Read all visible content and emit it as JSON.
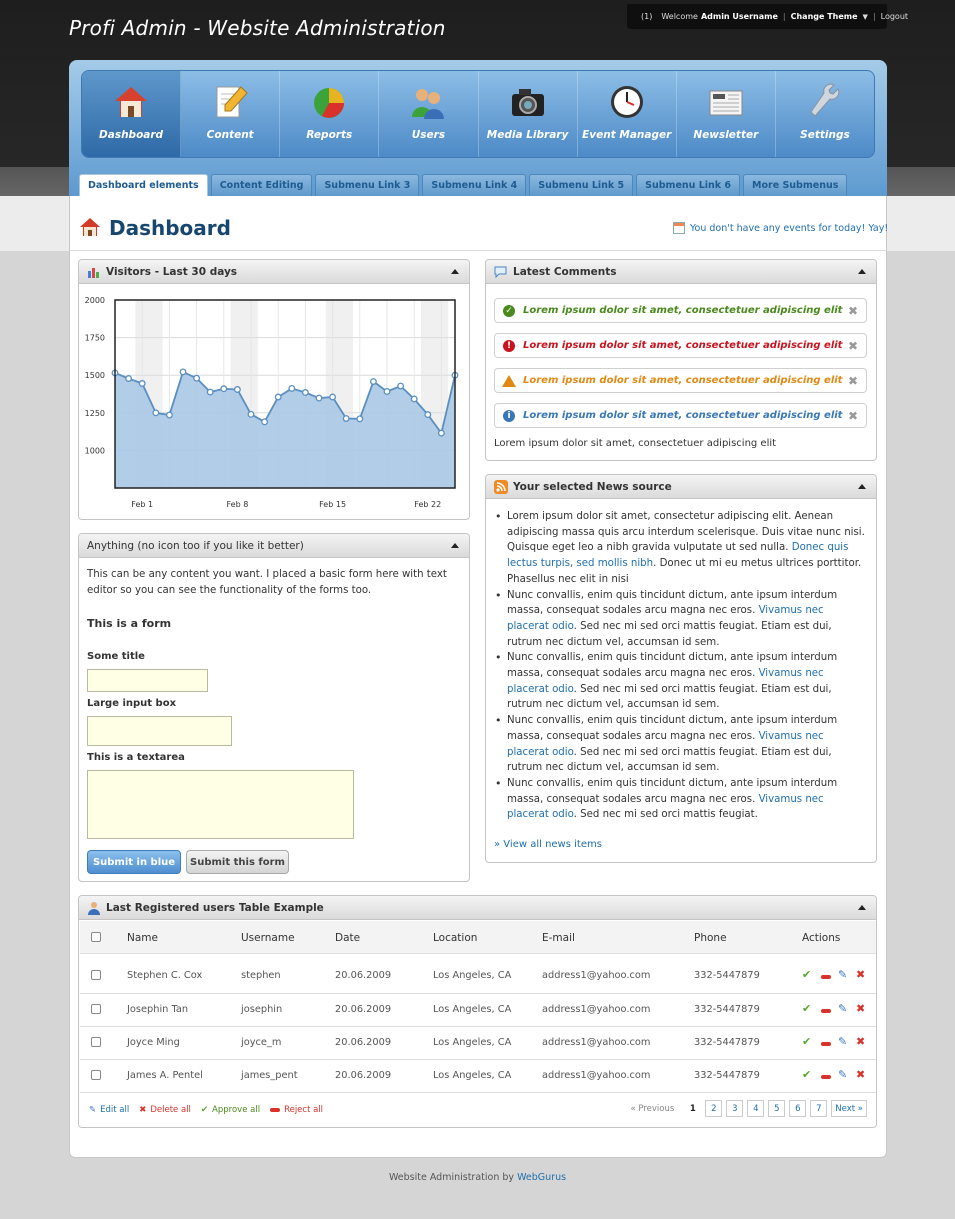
{
  "header": {
    "site_title": "Profi Admin - Website Administration",
    "userbar": {
      "mail_count": "(1)",
      "welcome": "Welcome",
      "username": "Admin Username",
      "change_theme": "Change Theme",
      "logout": "Logout"
    }
  },
  "nav": {
    "items": [
      {
        "label": "Dashboard",
        "icon": "house-icon",
        "active": true
      },
      {
        "label": "Content",
        "icon": "pencil-paper-icon"
      },
      {
        "label": "Reports",
        "icon": "pie-chart-icon"
      },
      {
        "label": "Users",
        "icon": "users-icon"
      },
      {
        "label": "Media Library",
        "icon": "camera-icon"
      },
      {
        "label": "Event Manager",
        "icon": "clock-icon"
      },
      {
        "label": "Newsletter",
        "icon": "newspaper-icon"
      },
      {
        "label": "Settings",
        "icon": "wrench-icon"
      }
    ]
  },
  "subnav": {
    "tabs": [
      {
        "label": "Dashboard elements",
        "active": true
      },
      {
        "label": "Content Editing"
      },
      {
        "label": "Submenu Link 3"
      },
      {
        "label": "Submenu Link 4"
      },
      {
        "label": "Submenu Link 5"
      },
      {
        "label": "Submenu Link 6"
      },
      {
        "label": "More Submenus"
      }
    ]
  },
  "page": {
    "title": "Dashboard",
    "events_notice": "You don't have any events for today! Yay!"
  },
  "visitors_panel": {
    "title": "Visitors - Last 30 days"
  },
  "chart_data": {
    "type": "area",
    "title": "Visitors - Last 30 days",
    "x_tick_labels": [
      "Feb 1",
      "Feb 8",
      "Feb 15",
      "Feb 22"
    ],
    "x_tick_positions": [
      3,
      10,
      17,
      24
    ],
    "y_ticks": [
      "2000",
      "1750",
      "1500",
      "1250",
      "1000"
    ],
    "ylim": [
      750,
      2000
    ],
    "grid": true,
    "values": [
      1515,
      1478,
      1445,
      1250,
      1235,
      1522,
      1480,
      1388,
      1410,
      1405,
      1240,
      1190,
      1355,
      1412,
      1385,
      1348,
      1355,
      1212,
      1210,
      1458,
      1392,
      1428,
      1342,
      1238,
      1115,
      1500
    ],
    "color": "#5b8fc0",
    "fill": "#a9c8e6"
  },
  "anything_panel": {
    "title": "Anything (no icon too if you like it better)",
    "intro": "This can be any content you want. I placed a basic form here with text editor so you can see the functionality of the forms too.",
    "form_heading": "This is a form",
    "field1_label": "Some title",
    "field2_label": "Large input box",
    "field3_label": "This is a textarea",
    "submit_blue": "Submit in blue",
    "submit_form": "Submit this form"
  },
  "comments_panel": {
    "title": "Latest Comments",
    "items": [
      {
        "text": "Lorem ipsum dolor sit amet, consectetuer adipiscing elit",
        "type": "success",
        "color": "#4a8a1c",
        "icon": "check-icon"
      },
      {
        "text": "Lorem ipsum dolor sit amet, consectetuer adipiscing elit",
        "type": "error",
        "color": "#c8141e",
        "icon": "error-icon"
      },
      {
        "text": "Lorem ipsum dolor sit amet, consectetuer adipiscing elit",
        "type": "warning",
        "color": "#e08a14",
        "icon": "warning-icon"
      },
      {
        "text": "Lorem ipsum dolor sit amet, consectetuer adipiscing elit",
        "type": "info",
        "color": "#3a78b5",
        "icon": "info-icon"
      }
    ],
    "plain_text": "Lorem ipsum dolor sit amet, consectetuer adipiscing elit"
  },
  "news_panel": {
    "title": "Your selected News source",
    "items": [
      {
        "text": "Lorem ipsum dolor sit amet, consectetur adipiscing elit. Aenean adipiscing massa quis arcu interdum scelerisque. Duis vitae nunc nisi. Quisque eget leo a nibh gravida vulputate ut sed nulla. ",
        "link": "Donec quis lectus turpis, sed mollis nibh",
        "after": ". Donec ut mi eu metus ultrices porttitor. Phasellus nec elit in nisi"
      },
      {
        "text": "Nunc convallis, enim quis tincidunt dictum, ante ipsum interdum massa, consequat sodales arcu magna nec eros. ",
        "link": "Vivamus nec placerat odio",
        "after": ". Sed nec mi sed orci mattis feugiat. Etiam est dui, rutrum nec dictum vel, accumsan id sem."
      },
      {
        "text": "Nunc convallis, enim quis tincidunt dictum, ante ipsum interdum massa, consequat sodales arcu magna nec eros. ",
        "link": "Vivamus nec placerat odio",
        "after": ". Sed nec mi sed orci mattis feugiat. Etiam est dui, rutrum nec dictum vel, accumsan id sem."
      },
      {
        "text": "Nunc convallis, enim quis tincidunt dictum, ante ipsum interdum massa, consequat sodales arcu magna nec eros. ",
        "link": "Vivamus nec placerat odio",
        "after": ". Sed nec mi sed orci mattis feugiat. Etiam est dui, rutrum nec dictum vel, accumsan id sem."
      },
      {
        "text": "Nunc convallis, enim quis tincidunt dictum, ante ipsum interdum massa, consequat sodales arcu magna nec eros. ",
        "link": "Vivamus nec placerat odio",
        "after": ". Sed nec mi sed orci mattis feugiat."
      }
    ],
    "view_all": "» View all news items"
  },
  "users_table": {
    "title": "Last Registered users Table Example",
    "columns": [
      "Name",
      "Username",
      "Date",
      "Location",
      "E-mail",
      "Phone",
      "Actions"
    ],
    "rows": [
      [
        "Stephen C. Cox",
        "stephen",
        "20.06.2009",
        "Los Angeles, CA",
        "address1@yahoo.com",
        "332-5447879"
      ],
      [
        "Josephin Tan",
        "josephin",
        "20.06.2009",
        "Los Angeles, CA",
        "address1@yahoo.com",
        "332-5447879"
      ],
      [
        "Joyce Ming",
        "joyce_m",
        "20.06.2009",
        "Los Angeles, CA",
        "address1@yahoo.com",
        "332-5447879"
      ],
      [
        "James A. Pentel",
        "james_pent",
        "20.06.2009",
        "Los Angeles, CA",
        "address1@yahoo.com",
        "332-5447879"
      ]
    ],
    "bulk": {
      "edit": "Edit all",
      "delete": "Delete all",
      "approve": "Approve all",
      "reject": "Reject all"
    },
    "pager": {
      "previous": "« Previous",
      "pages": [
        "1",
        "2",
        "3",
        "4",
        "5",
        "6",
        "7"
      ],
      "current": "1",
      "next": "Next »"
    }
  },
  "footer": {
    "text": "Website Administration by",
    "link": "WebGurus"
  }
}
